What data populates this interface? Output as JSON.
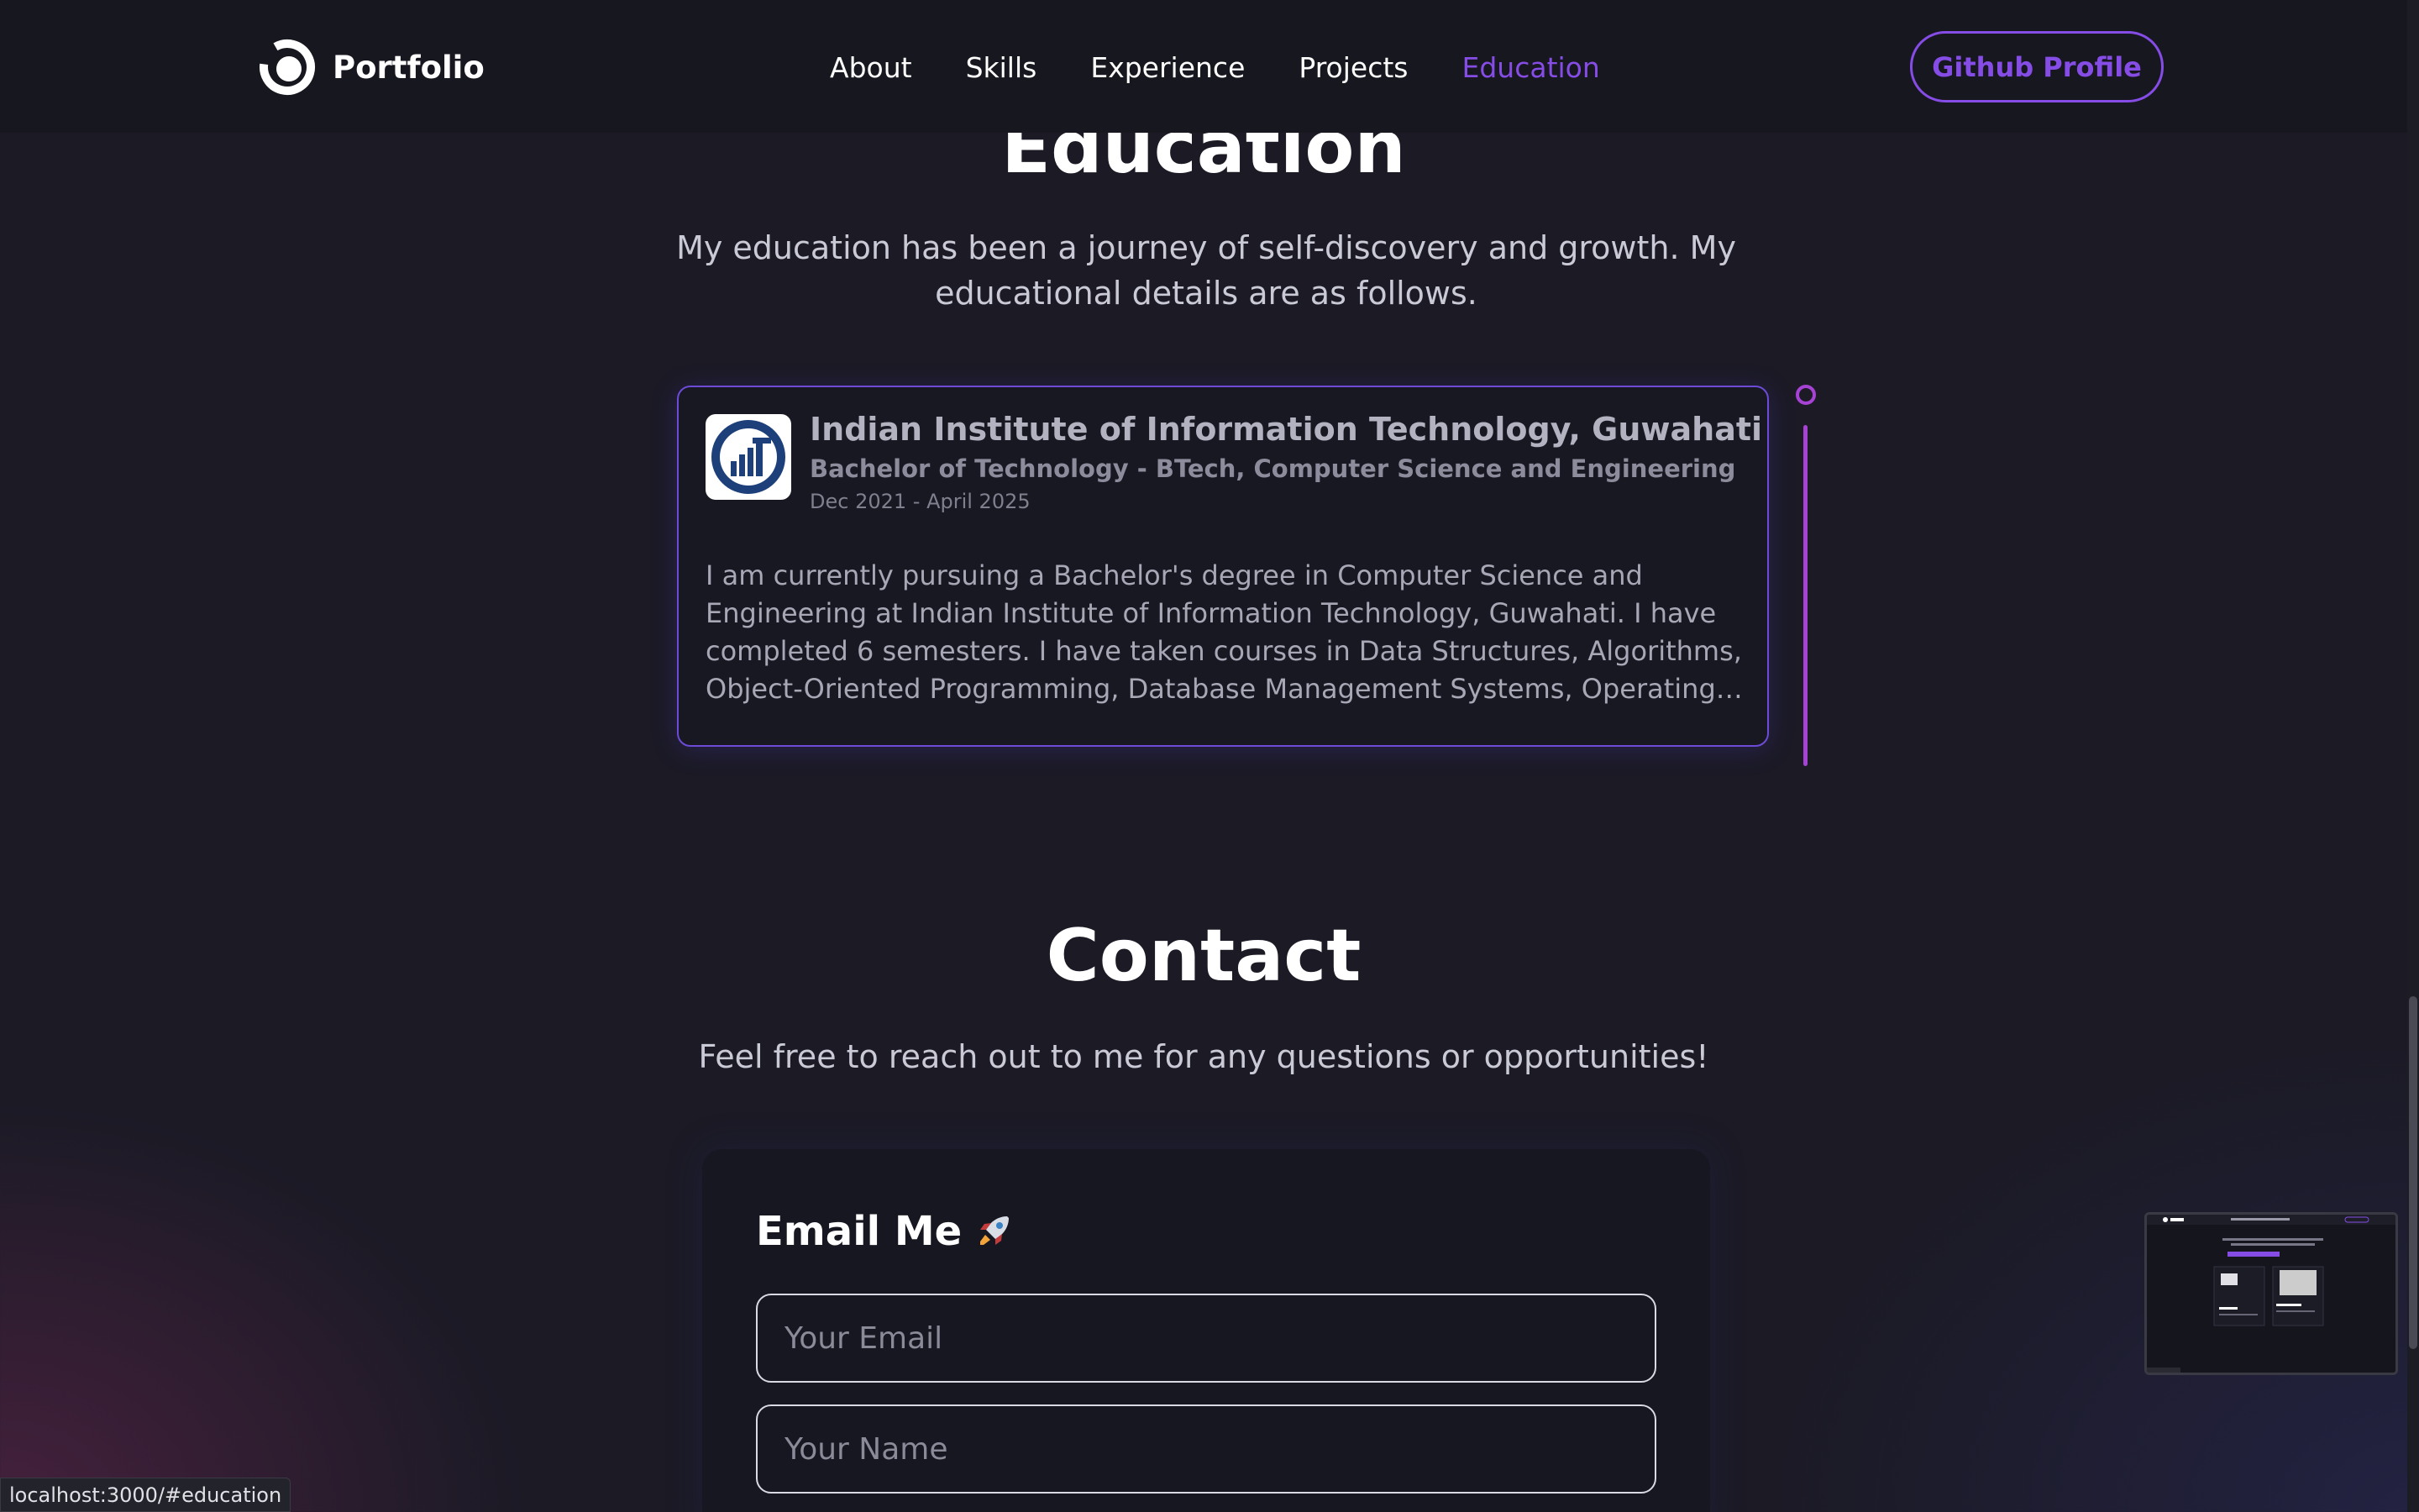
{
  "navbar": {
    "brand": "Portfolio",
    "links": [
      "About",
      "Skills",
      "Experience",
      "Projects",
      "Education"
    ],
    "active_link": "Education",
    "github_button": "Github Profile"
  },
  "education": {
    "title": "Education",
    "description": "My education has been a journey of self-discovery and growth. My educational details are as follows.",
    "entries": [
      {
        "school": "Indian Institute of Information Technology, Guwahati",
        "degree": "Bachelor of Technology - BTech, Computer Science and Engineering",
        "dates": "Dec 2021 - April 2025",
        "text": "I am currently pursuing a Bachelor's degree in Computer Science and Engineering at Indian Institute of Information Technology, Guwahati. I have completed 6 semesters. I have taken courses in Data Structures, Algorithms, Object-Oriented Programming, Database Management Systems, Operating Systems, and Computer Networks."
      }
    ]
  },
  "contact": {
    "title": "Contact",
    "description": "Feel free to reach out to me for any questions or opportunities!",
    "form_title": "Email Me",
    "email_placeholder": "Your Email",
    "name_placeholder": "Your Name"
  },
  "status_bar": {
    "url": "localhost:3000/#education"
  },
  "colors": {
    "accent": "#854ce6",
    "timeline": "#a642d4",
    "background": "#1b1a25"
  }
}
